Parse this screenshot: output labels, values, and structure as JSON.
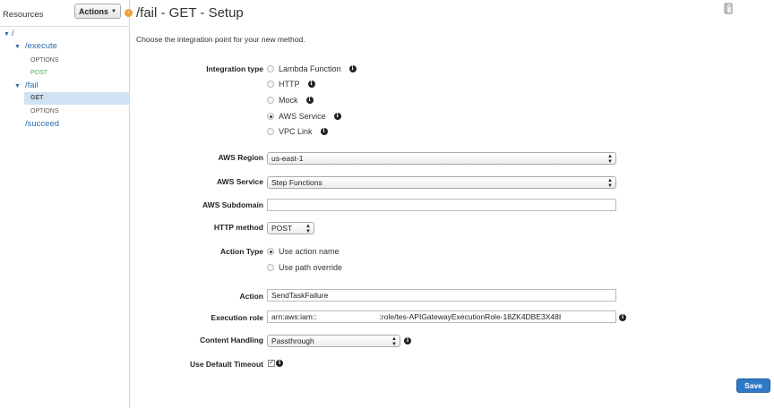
{
  "sidebar": {
    "title": "Resources",
    "actions_label": "Actions",
    "tree": {
      "root": "/",
      "execute": "/execute",
      "execute_options": "OPTIONS",
      "execute_post": "POST",
      "fail": "/fail",
      "fail_get": "GET",
      "fail_options": "OPTIONS",
      "succeed": "/succeed"
    }
  },
  "page": {
    "title": "/fail - GET - Setup",
    "intro": "Choose the integration point for your new method."
  },
  "form": {
    "integration_type": {
      "label": "Integration type",
      "options": [
        "Lambda Function",
        "HTTP",
        "Mock",
        "AWS Service",
        "VPC Link"
      ],
      "selected": "AWS Service"
    },
    "aws_region": {
      "label": "AWS Region",
      "value": "us-east-1"
    },
    "aws_service": {
      "label": "AWS Service",
      "value": "Step Functions"
    },
    "aws_subdomain": {
      "label": "AWS Subdomain",
      "value": ""
    },
    "http_method": {
      "label": "HTTP method",
      "value": "POST"
    },
    "action_type": {
      "label": "Action Type",
      "options": [
        "Use action name",
        "Use path override"
      ],
      "selected": "Use action name"
    },
    "action": {
      "label": "Action",
      "value": "SendTaskFailure"
    },
    "execution_role": {
      "label": "Execution role",
      "value_prefix": "arn:aws:iam::",
      "value_suffix": ":role/tes-APIGatewayExecutionRole-18ZK4DBE3X48I"
    },
    "content_handling": {
      "label": "Content Handling",
      "value": "Passthrough"
    },
    "default_timeout": {
      "label": "Use Default Timeout",
      "checked": true
    }
  },
  "save_label": "Save",
  "colors": {
    "accent": "#2f7ac6",
    "link": "#2d6bb0",
    "selected_row": "#cfe2f3",
    "toggle": "#f0a03c"
  }
}
